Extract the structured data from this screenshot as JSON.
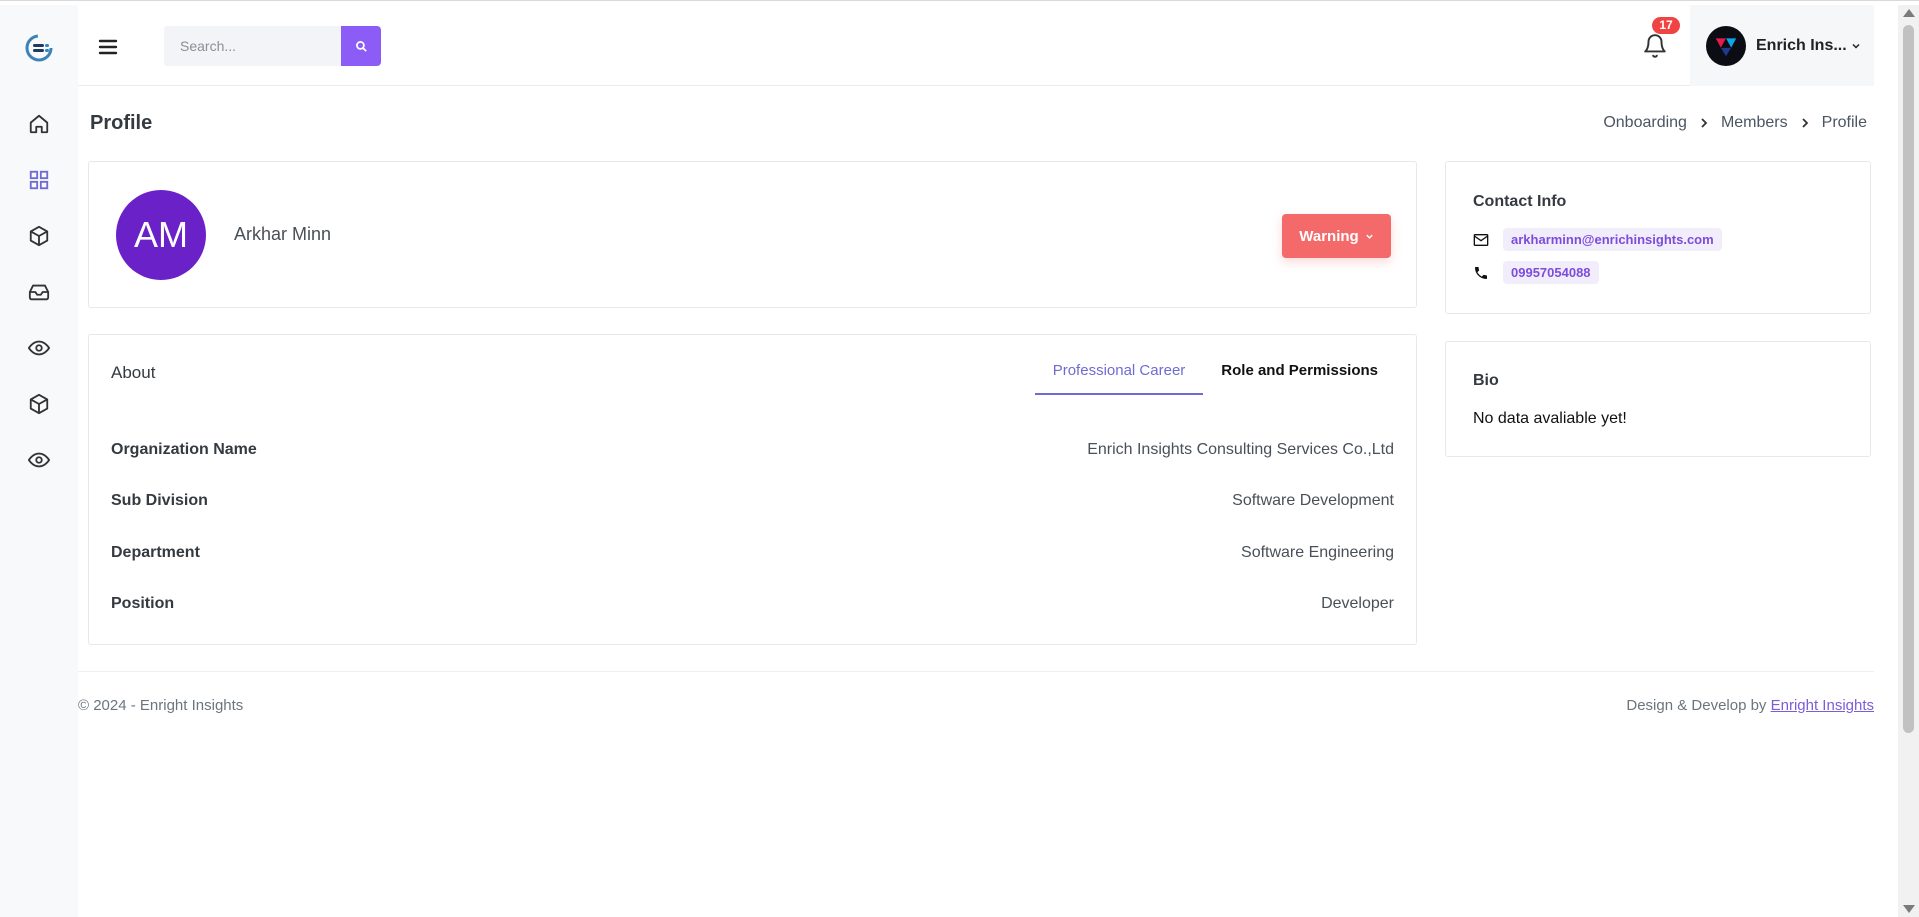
{
  "header": {
    "search_placeholder": "Search...",
    "notifications_count": "17",
    "user_name": "Enrich Ins..."
  },
  "page": {
    "title": "Profile",
    "breadcrumb": [
      "Onboarding",
      "Members",
      "Profile"
    ]
  },
  "profile": {
    "initials": "AM",
    "name": "Arkhar Minn",
    "status_button": "Warning"
  },
  "about": {
    "label": "About",
    "tabs": [
      {
        "label": "Professional Career",
        "active": true
      },
      {
        "label": "Role and Permissions",
        "active": false
      }
    ],
    "rows": [
      {
        "key": "Organization Name",
        "value": "Enrich Insights Consulting Services Co.,Ltd"
      },
      {
        "key": "Sub Division",
        "value": "Software Development"
      },
      {
        "key": "Department",
        "value": "Software Engineering"
      },
      {
        "key": "Position",
        "value": "Developer"
      }
    ]
  },
  "contact": {
    "title": "Contact Info",
    "email": "arkharminn@enrichinsights.com",
    "phone": "09957054088"
  },
  "bio": {
    "title": "Bio",
    "text": "No data avaliable yet!"
  },
  "footer": {
    "copyright": "© 2024 - Enright Insights",
    "credit_prefix": "Design & Develop by ",
    "credit_link": "Enright Insights"
  },
  "icons": {
    "sidebar": [
      "home-icon",
      "dashboard-grid-icon",
      "cube-icon",
      "inbox-icon",
      "eye-icon",
      "cube-icon",
      "eye-icon"
    ]
  },
  "colors": {
    "accent": "#8b5cf6",
    "warning": "#f46a6a",
    "avatar": "#6b21c8",
    "tab_active": "#6f6bd4",
    "badge": "#f04444"
  }
}
